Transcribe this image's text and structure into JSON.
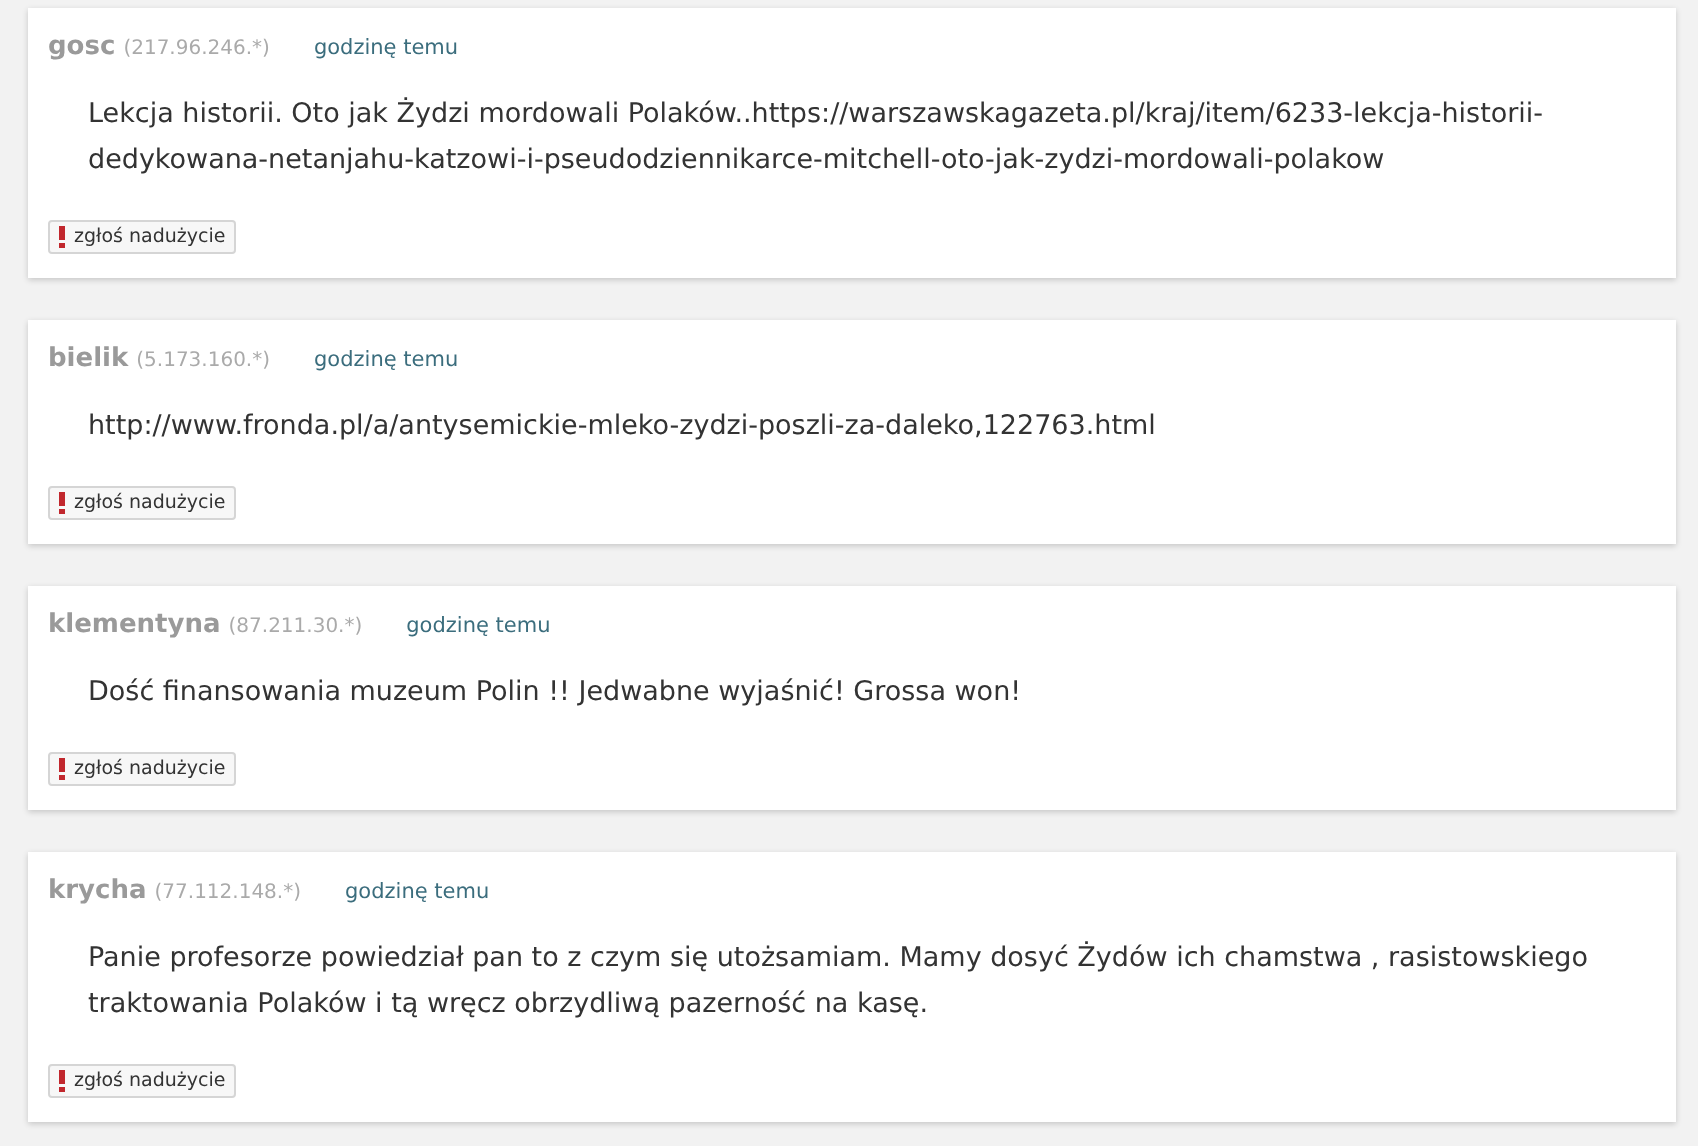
{
  "comments": [
    {
      "author": "gosc",
      "ip": "(217.96.246.*)",
      "time": "godzinę temu",
      "text": "Lekcja historii. Oto jak Żydzi mordowali Polaków..https://warszawskagazeta.pl/kraj/item/6233-lekcja-historii-dedykowana-netanjahu-katzowi-i-pseudodziennikarce-mitchell-oto-jak-zydzi-mordowali-polakow",
      "report": "zgłoś nadużycie"
    },
    {
      "author": "bielik",
      "ip": "(5.173.160.*)",
      "time": "godzinę temu",
      "text": "http://www.fronda.pl/a/antysemickie-mleko-zydzi-poszli-za-daleko,122763.html",
      "report": "zgłoś nadużycie"
    },
    {
      "author": "klementyna",
      "ip": "(87.211.30.*)",
      "time": "godzinę temu",
      "text": "Dość finansowania muzeum Polin !! Jedwabne wyjaśnić! Grossa won!",
      "report": "zgłoś nadużycie"
    },
    {
      "author": "krycha",
      "ip": "(77.112.148.*)",
      "time": "godzinę temu",
      "text": "Panie profesorze powiedział pan to z czym się utożsamiam. Mamy dosyć Żydów ich chamstwa , rasistowskiego traktowania Polaków i tą wręcz obrzydliwą pazerność na kasę.",
      "report": "zgłoś nadużycie"
    }
  ]
}
